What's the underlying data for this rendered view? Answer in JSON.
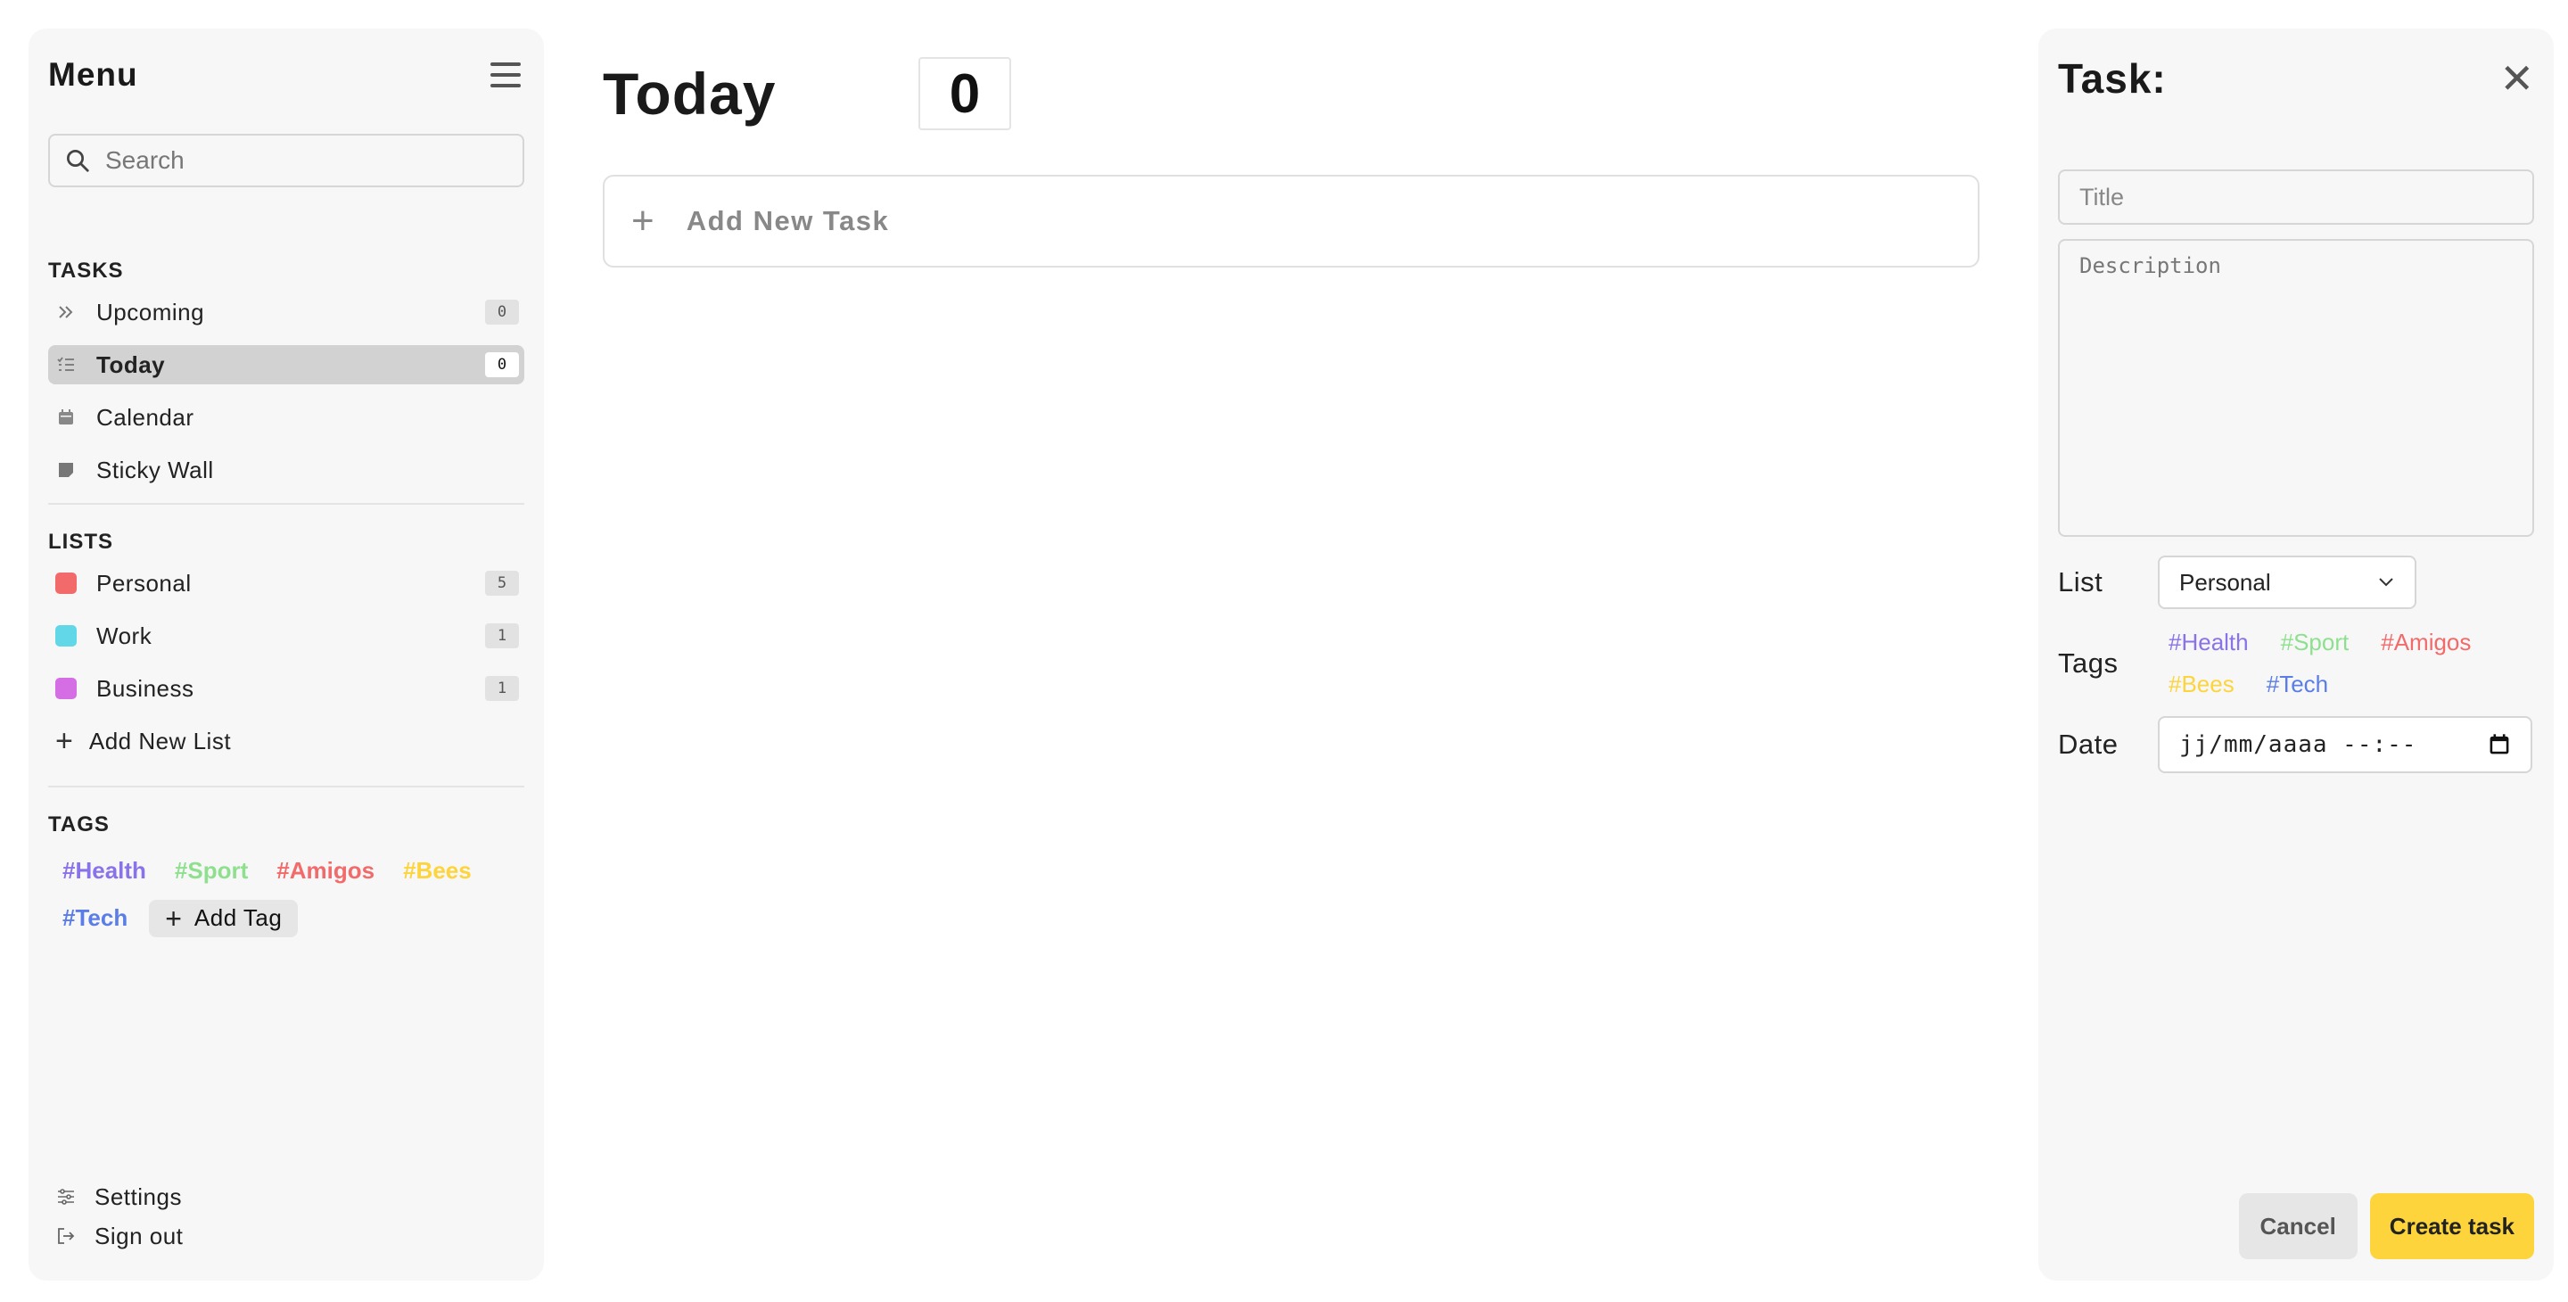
{
  "sidebar": {
    "title": "Menu",
    "search_placeholder": "Search",
    "tasks_heading": "TASKS",
    "tasks": [
      {
        "label": "Upcoming",
        "count": "0",
        "icon": "double-chevron-right-icon"
      },
      {
        "label": "Today",
        "count": "0",
        "icon": "list-check-icon",
        "active": true
      },
      {
        "label": "Calendar",
        "icon": "calendar-icon"
      },
      {
        "label": "Sticky Wall",
        "icon": "sticky-note-icon"
      }
    ],
    "lists_heading": "LISTS",
    "lists": [
      {
        "label": "Personal",
        "count": "5",
        "color": "#f26a6a"
      },
      {
        "label": "Work",
        "count": "1",
        "color": "#61d7e7"
      },
      {
        "label": "Business",
        "count": "1",
        "color": "#d56ee5"
      }
    ],
    "add_list_label": "Add New List",
    "tags_heading": "TAGS",
    "tags": [
      {
        "label": "#Health",
        "color": "#8a72e8"
      },
      {
        "label": "#Sport",
        "color": "#8ee08e"
      },
      {
        "label": "#Amigos",
        "color": "#f26a6a"
      },
      {
        "label": "#Bees",
        "color": "#fdd43b"
      },
      {
        "label": "#Tech",
        "color": "#5b7de8"
      }
    ],
    "add_tag_label": "Add Tag",
    "settings_label": "Settings",
    "signout_label": "Sign out"
  },
  "main": {
    "title": "Today",
    "count": "0",
    "add_task_label": "Add New Task"
  },
  "panel": {
    "title": "Task:",
    "title_placeholder": "Title",
    "description_placeholder": "Description",
    "list_label": "List",
    "list_value": "Personal",
    "tags_label": "Tags",
    "tags": [
      {
        "label": "#Health",
        "color": "#8a72e8"
      },
      {
        "label": "#Sport",
        "color": "#8ee08e"
      },
      {
        "label": "#Amigos",
        "color": "#f26a6a"
      },
      {
        "label": "#Bees",
        "color": "#fdd43b"
      },
      {
        "label": "#Tech",
        "color": "#5b7de8"
      }
    ],
    "date_label": "Date",
    "date_value": "jj/mm/aaaa --:--",
    "cancel_label": "Cancel",
    "create_label": "Create task"
  },
  "colors": {
    "accent": "#fdd43b",
    "panel_bg": "#f7f7f7",
    "active_item_bg": "#d2d2d2"
  }
}
